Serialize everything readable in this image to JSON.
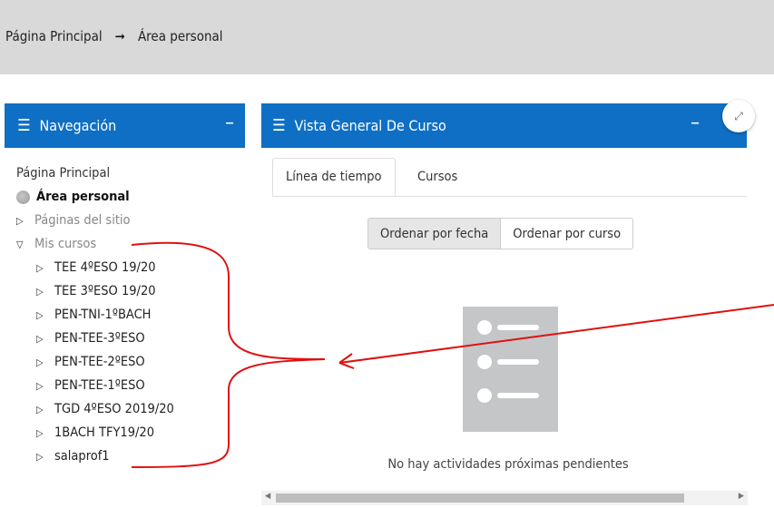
{
  "breadcrumb": {
    "home": "Página Principal",
    "current": "Área personal"
  },
  "navigation": {
    "title": "Navegación",
    "items": [
      {
        "label": "Página Principal"
      },
      {
        "label": "Área personal"
      },
      {
        "label": "Páginas del sitio"
      },
      {
        "label": "Mis cursos"
      }
    ],
    "courses": [
      "TEE 4ºESO 19/20",
      "TEE 3ºESO 19/20",
      "PEN-TNI-1ºBACH",
      "PEN-TEE-3ºESO",
      "PEN-TEE-2ºESO",
      "PEN-TEE-1ºESO",
      "TGD 4ºESO 2019/20",
      "1BACH TFY19/20",
      "salaprof1"
    ]
  },
  "course_overview": {
    "title": "Vista General De Curso",
    "tabs": [
      {
        "label": "Línea de tiempo"
      },
      {
        "label": "Cursos"
      }
    ],
    "sort_buttons": [
      {
        "label": "Ordenar por fecha"
      },
      {
        "label": "Ordenar por curso"
      }
    ],
    "empty_message": "No hay actividades próximas pendientes"
  },
  "colors": {
    "header_blue": "#0f6fc5",
    "annotation_red": "#e01010",
    "breadcrumb_bg": "#d9d9d9"
  }
}
